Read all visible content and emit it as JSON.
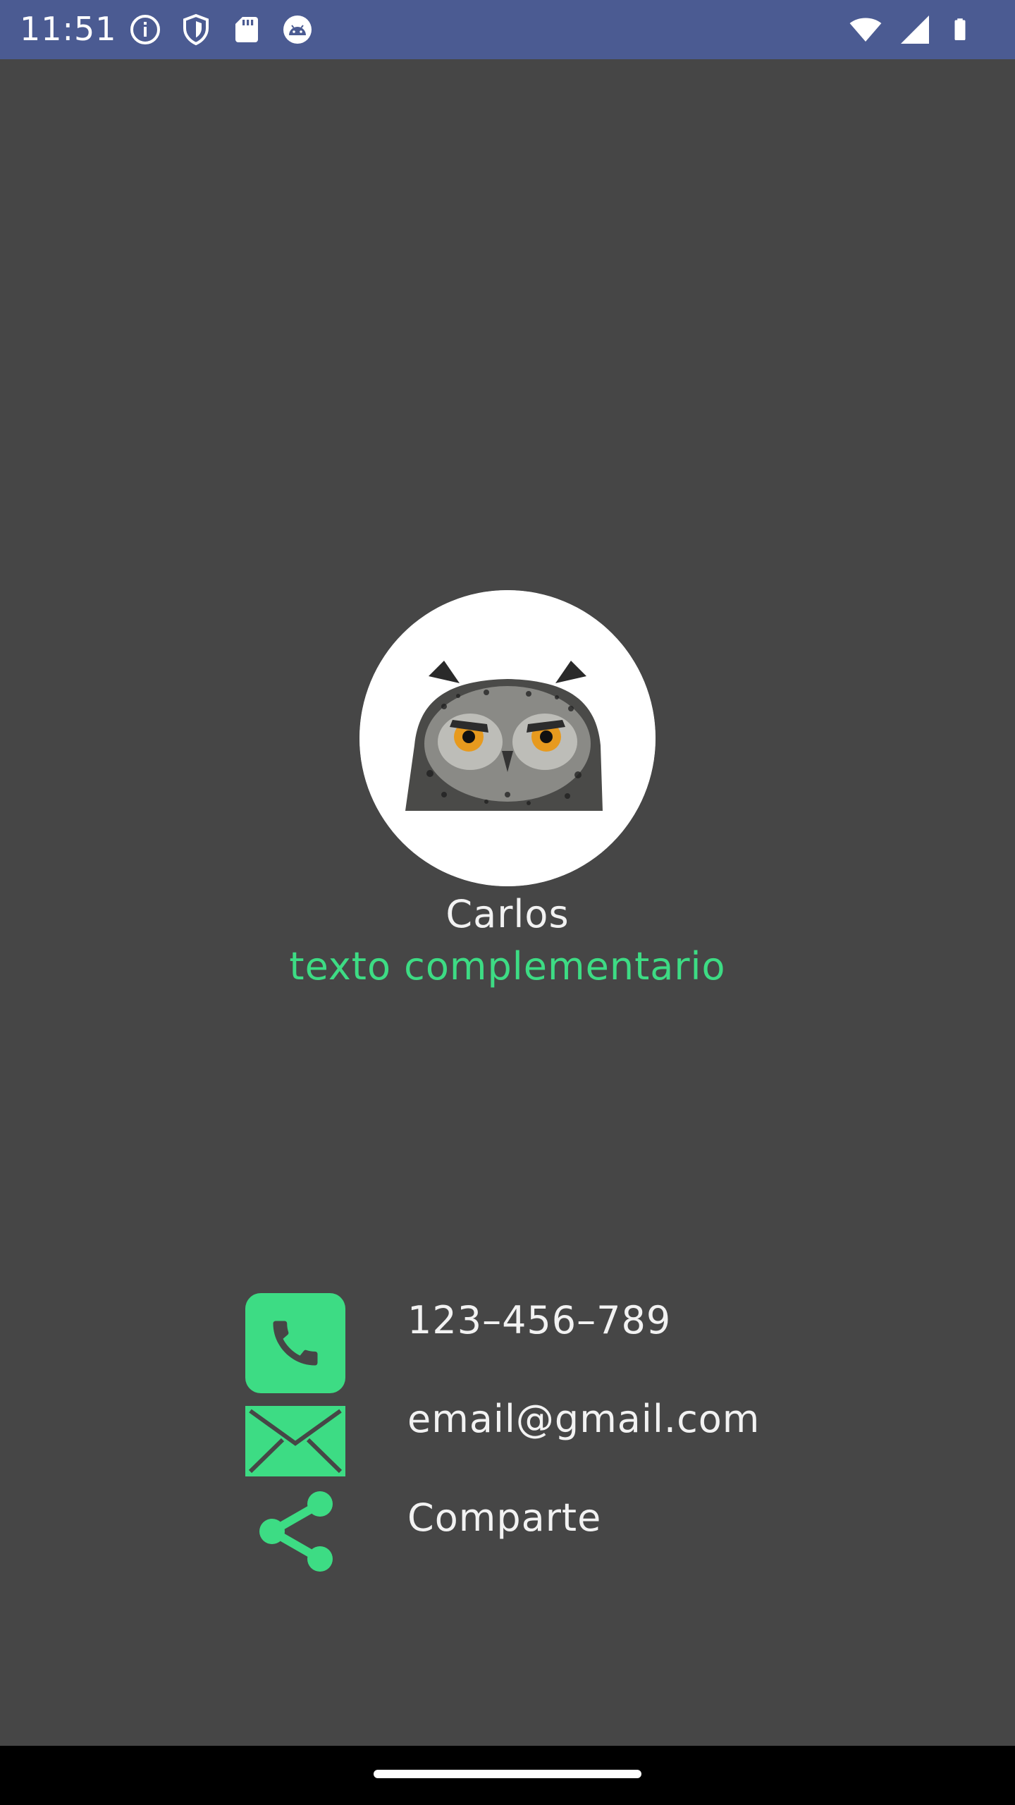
{
  "status_bar": {
    "time": "11:51",
    "left_icons": [
      "info-icon",
      "shield-icon",
      "sd-card-icon",
      "android-debug-icon"
    ],
    "right_icons": [
      "wifi-icon",
      "cell-signal-icon",
      "battery-icon"
    ],
    "background": "#4b5b92"
  },
  "profile": {
    "avatar_icon": "owl-photo",
    "name": "Carlos",
    "subtitle": "texto complementario"
  },
  "contacts": [
    {
      "icon": "phone-icon",
      "text": "123–456–789"
    },
    {
      "icon": "email-icon",
      "text": "email@gmail.com"
    },
    {
      "icon": "share-icon",
      "text": "Comparte"
    }
  ],
  "colors": {
    "background": "#464646",
    "accent": "#3ddc84",
    "text": "#f2f2f2"
  }
}
